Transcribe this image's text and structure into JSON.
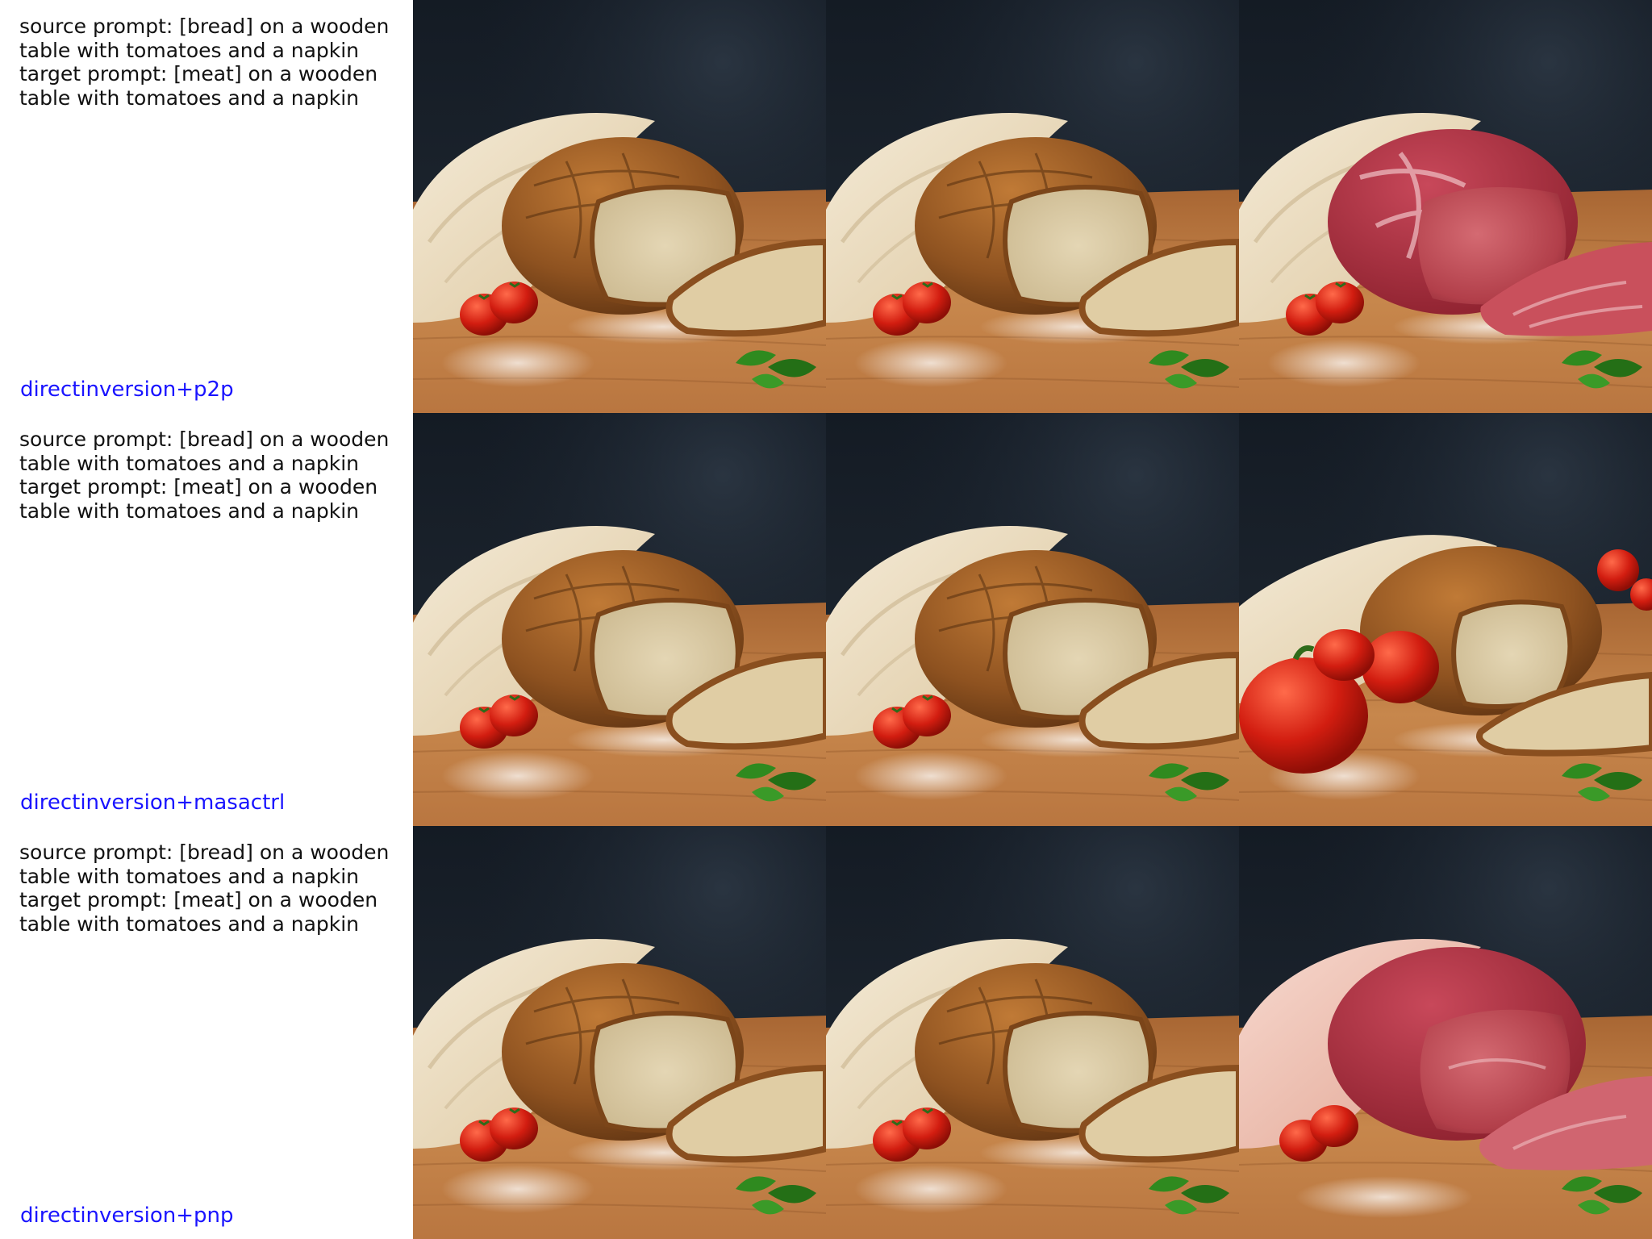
{
  "rows": [
    {
      "prompt": {
        "line1": "source prompt: [bread] on a wooden",
        "line2": "table with tomatoes and a napkin",
        "line3": "target prompt: [meat] on a wooden",
        "line4": "table with tomatoes and a napkin"
      },
      "method": "directinversion+p2p",
      "images": [
        "bread",
        "bread",
        "meat"
      ]
    },
    {
      "prompt": {
        "line1": "source prompt: [bread] on a wooden",
        "line2": "table with tomatoes and a napkin",
        "line3": "target prompt: [meat] on a wooden",
        "line4": "table with tomatoes and a napkin"
      },
      "method": "directinversion+masactrl",
      "images": [
        "bread",
        "bread",
        "bread-with-peppers"
      ]
    },
    {
      "prompt": {
        "line1": "source prompt: [bread] on a wooden",
        "line2": "table with tomatoes and a napkin",
        "line3": "target prompt: [meat] on a wooden",
        "line4": "table with tomatoes and a napkin"
      },
      "method": "directinversion+pnp",
      "images": [
        "bread",
        "bread",
        "meat-pink-napkin"
      ]
    }
  ],
  "colors": {
    "method_label": "#1a14ff",
    "background_dark": "#1b2430",
    "table_wood": "#b9773f",
    "bread_crust": "#8a4f1f",
    "bread_crumb": "#d9c9a4",
    "meat": "#b8404a",
    "tomato": "#c81d12",
    "napkin": "#efe3cc"
  }
}
